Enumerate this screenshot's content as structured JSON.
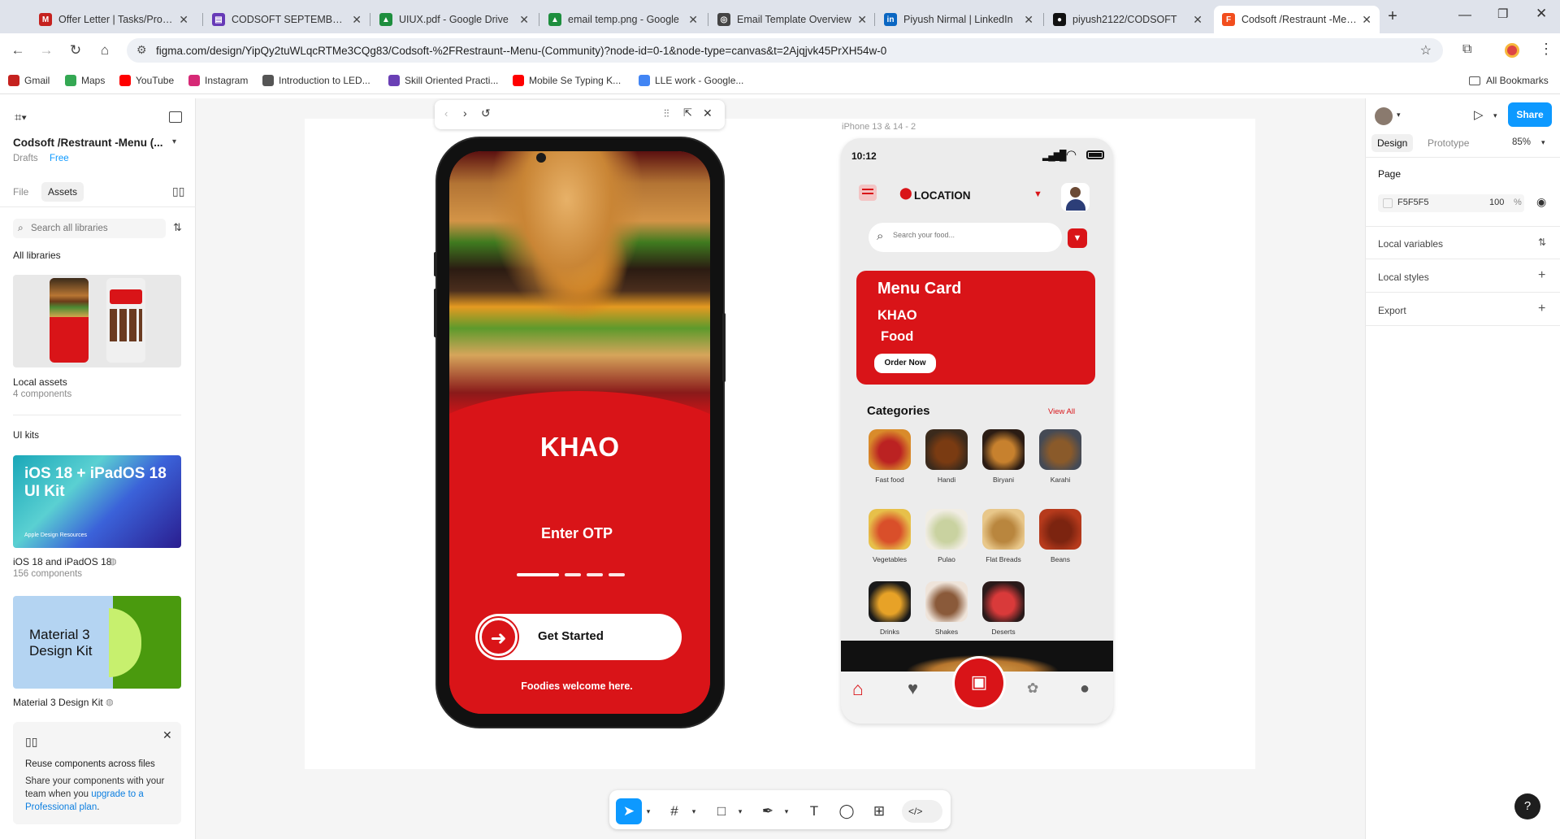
{
  "tabs": [
    {
      "title": "Offer Letter | Tasks/Projec",
      "fav_color": "#c5221f",
      "fav": "M"
    },
    {
      "title": "CODSOFT SEPTEMBER TA",
      "fav_color": "#673ab7",
      "fav": "▤"
    },
    {
      "title": "UIUX.pdf - Google Drive",
      "fav_color": "#1e8e3e",
      "fav": "▲"
    },
    {
      "title": "email temp.png - Google",
      "fav_color": "#1e8e3e",
      "fav": "▲"
    },
    {
      "title": "Email Template Overview",
      "fav_color": "#444",
      "fav": "◎"
    },
    {
      "title": "Piyush Nirmal | LinkedIn",
      "fav_color": "#0a66c2",
      "fav": "in"
    },
    {
      "title": "piyush2122/CODSOFT",
      "fav_color": "#111",
      "fav": "●"
    },
    {
      "title": "Codsoft /Restraunt -Menu",
      "fav_color": "#f24e1e",
      "fav": "F"
    }
  ],
  "address": {
    "url": "figma.com/design/YipQy2tuWLqcRTMe3CQg83/Codsoft-%2FRestraunt--Menu-(Community)?node-id=0-1&node-type=canvas&t=2Ajqjvk45PrXH54w-0"
  },
  "bookmarks": [
    {
      "label": "Gmail",
      "color": "#c5221f"
    },
    {
      "label": "Maps",
      "color": "#34a853"
    },
    {
      "label": "YouTube",
      "color": "#ff0000"
    },
    {
      "label": "Instagram",
      "color": "#d62976"
    },
    {
      "label": "Introduction to LED...",
      "color": "#555"
    },
    {
      "label": "Skill Oriented Practi...",
      "color": "#6a3fb5"
    },
    {
      "label": "Mobile Se Typing K...",
      "color": "#ff0000"
    },
    {
      "label": "LLE work - Google...",
      "color": "#4285f4"
    }
  ],
  "all_bookmarks": "All Bookmarks",
  "left": {
    "file_title": "Codsoft /Restraunt -Menu (...",
    "drafts": "Drafts",
    "plan": "Free",
    "tab_file": "File",
    "tab_assets": "Assets",
    "search_placeholder": "Search all libraries",
    "all_libraries": "All libraries",
    "local_assets": "Local assets",
    "local_count": "4 components",
    "ui_kits": "UI kits",
    "ios_kit_title": "iOS 18 + iPadOS 18 UI Kit",
    "ios_kit_sub": "Apple Design Resources",
    "ios_name": "iOS 18 and iPadOS 18",
    "ios_count": "156 components",
    "material_title": "Material 3 Design Kit",
    "material_name": "Material 3 Design Kit",
    "reuse_title": "Reuse components across files",
    "reuse_body": "Share your components with your team when you",
    "reuse_link": "upgrade to a Professional plan",
    "reuse_end": "."
  },
  "frame_label": "iPhone 13 & 14 - 2",
  "phone1": {
    "brand": "KHAO",
    "otp": "Enter OTP",
    "cta": "Get Started",
    "tagline": "Foodies welcome here."
  },
  "phone2": {
    "time": "10:12",
    "location": "LOCATION",
    "search_placeholder": "Search your food...",
    "menu_title": "Menu Card",
    "khao": "KHAO",
    "food": "Food",
    "order": "Order Now",
    "categories": "Categories",
    "view_all": "View All",
    "items": [
      {
        "label": "Fast food",
        "c1": "#d98b2b",
        "c2": "#b22"
      },
      {
        "label": "Handi",
        "c1": "#3b2a1c",
        "c2": "#7a3b12"
      },
      {
        "label": "Biryani",
        "c1": "#2b1c14",
        "c2": "#c7812e"
      },
      {
        "label": "Karahi",
        "c1": "#454a55",
        "c2": "#8a5a2a"
      },
      {
        "label": "Vegetables",
        "c1": "#e7c04a",
        "c2": "#d94f2a"
      },
      {
        "label": "Pulao",
        "c1": "#f1ede4",
        "c2": "#c9d2a0"
      },
      {
        "label": "Flat Breads",
        "c1": "#e8c78a",
        "c2": "#b9863e"
      },
      {
        "label": "Beans",
        "c1": "#b63a1c",
        "c2": "#7c2410"
      },
      {
        "label": "Drinks",
        "c1": "#1a1a1a",
        "c2": "#e7a227"
      },
      {
        "label": "Shakes",
        "c1": "#efe4da",
        "c2": "#8a5a3a"
      },
      {
        "label": "Deserts",
        "c1": "#2a1a1a",
        "c2": "#d93a3a"
      }
    ]
  },
  "right": {
    "share": "Share",
    "design": "Design",
    "prototype": "Prototype",
    "zoom": "85%",
    "page": "Page",
    "bg_color": "F5F5F5",
    "opacity": "100",
    "pct": "%",
    "local_variables": "Local variables",
    "local_styles": "Local styles",
    "export": "Export"
  },
  "help": "?"
}
